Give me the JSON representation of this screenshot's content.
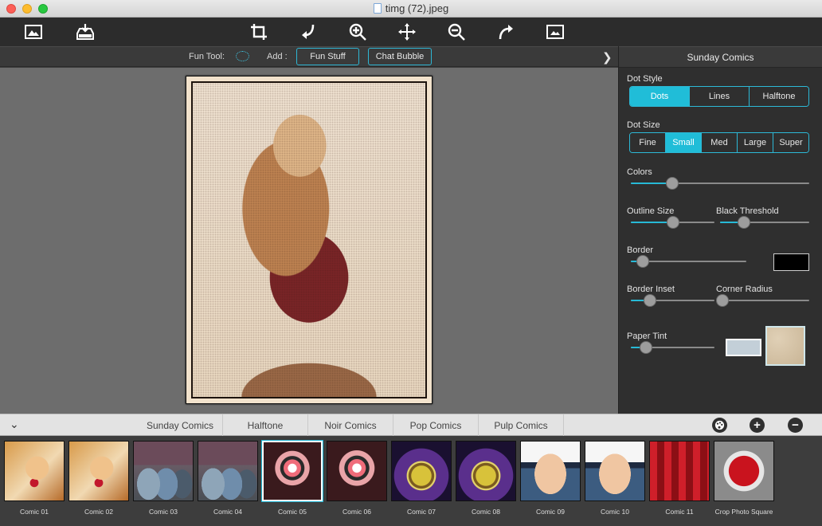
{
  "window": {
    "title": "timg (72).jpeg"
  },
  "toolbar": {
    "buttons": [
      "open-image-icon",
      "save-icon",
      "crop-icon",
      "rotate-left-icon",
      "zoom-in-icon",
      "move-icon",
      "zoom-out-icon",
      "redo-icon",
      "fit-image-icon"
    ]
  },
  "funbar": {
    "fun_tool_label": "Fun Tool:",
    "add_label": "Add :",
    "fun_stuff": "Fun Stuff",
    "chat_bubble": "Chat Bubble"
  },
  "panel": {
    "title": "Sunday Comics",
    "dot_style": {
      "label": "Dot Style",
      "options": [
        "Dots",
        "Lines",
        "Halftone"
      ],
      "selected": "Dots"
    },
    "dot_size": {
      "label": "Dot Size",
      "options": [
        "Fine",
        "Small",
        "Med",
        "Large",
        "Super"
      ],
      "selected": "Small"
    },
    "colors": {
      "label": "Colors",
      "value": 0.23
    },
    "outline_size": {
      "label": "Outline Size",
      "value": 0.5
    },
    "black_threshold": {
      "label": "Black Threshold",
      "value": 0.27
    },
    "border": {
      "label": "Border",
      "value": 0.1,
      "color": "#000000"
    },
    "border_inset": {
      "label": "Border Inset",
      "value": 0.23
    },
    "corner_radius": {
      "label": "Corner Radius",
      "value": 0.03
    },
    "paper_tint": {
      "label": "Paper Tint",
      "value": 0.18,
      "color": "#c3cfd8"
    }
  },
  "tabs": {
    "items": [
      "Sunday Comics",
      "Halftone",
      "Noir Comics",
      "Pop Comics",
      "Pulp Comics"
    ],
    "active": "Sunday Comics"
  },
  "filmstrip": {
    "items": [
      {
        "label": "Comic 01",
        "style": "g-face"
      },
      {
        "label": "Comic 02",
        "style": "g-face"
      },
      {
        "label": "Comic 03",
        "style": "g-cans"
      },
      {
        "label": "Comic 04",
        "style": "g-cans"
      },
      {
        "label": "Comic 05",
        "style": "g-star",
        "selected": true
      },
      {
        "label": "Comic 06",
        "style": "g-star"
      },
      {
        "label": "Comic 07",
        "style": "g-clock"
      },
      {
        "label": "Comic 08",
        "style": "g-clock"
      },
      {
        "label": "Comic 09",
        "style": "g-man"
      },
      {
        "label": "Comic 10",
        "style": "g-man"
      },
      {
        "label": "Comic 11",
        "style": "g-diner"
      },
      {
        "label": "Crop Photo Square",
        "style": "g-crop"
      }
    ]
  },
  "colors": {
    "accent": "#20bdd8"
  }
}
